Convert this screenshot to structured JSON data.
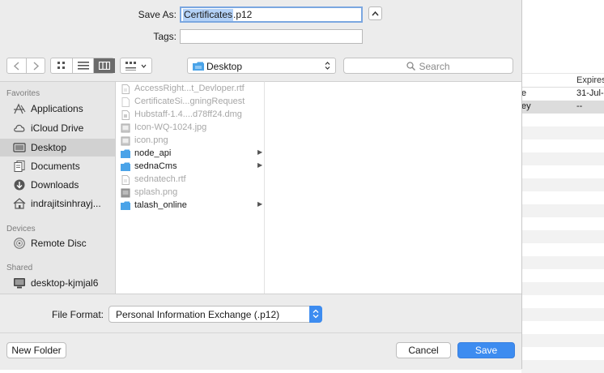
{
  "dialog": {
    "save_as_label": "Save As:",
    "filename_selected": "Certificates",
    "filename_ext": ".p12",
    "tags_label": "Tags:",
    "tags_value": ""
  },
  "toolbar": {
    "location": "Desktop",
    "search_placeholder": "Search"
  },
  "sidebar": {
    "favorites_header": "Favorites",
    "favorites": [
      {
        "label": "Applications",
        "icon": "applications-icon"
      },
      {
        "label": "iCloud Drive",
        "icon": "cloud-icon"
      },
      {
        "label": "Desktop",
        "icon": "desktop-icon",
        "active": true
      },
      {
        "label": "Documents",
        "icon": "documents-icon"
      },
      {
        "label": "Downloads",
        "icon": "downloads-icon"
      },
      {
        "label": "indrajitsinhrayj...",
        "icon": "home-icon"
      }
    ],
    "devices_header": "Devices",
    "devices": [
      {
        "label": "Remote Disc",
        "icon": "disc-icon"
      }
    ],
    "shared_header": "Shared",
    "shared": [
      {
        "label": "desktop-kjmjal6",
        "icon": "computer-icon"
      }
    ]
  },
  "files": [
    {
      "name": "AccessRight...t_Devloper.rtf",
      "kind": "doc",
      "dim": true
    },
    {
      "name": "CertificateSi...gningRequest",
      "kind": "blank",
      "dim": true
    },
    {
      "name": "Hubstaff-1.4....d78ff24.dmg",
      "kind": "dmg",
      "dim": true
    },
    {
      "name": "Icon-WQ-1024.jpg",
      "kind": "image",
      "dim": true
    },
    {
      "name": "icon.png",
      "kind": "image",
      "dim": true
    },
    {
      "name": "node_api",
      "kind": "folder",
      "dim": false
    },
    {
      "name": "sednaCms",
      "kind": "folder",
      "dim": false
    },
    {
      "name": "sednatech.rtf",
      "kind": "doc",
      "dim": true
    },
    {
      "name": "splash.png",
      "kind": "image",
      "dim": true
    },
    {
      "name": "talash_online",
      "kind": "folder",
      "dim": false
    }
  ],
  "format": {
    "label": "File Format:",
    "value": "Personal Information Exchange (.p12)"
  },
  "buttons": {
    "new_folder": "New Folder",
    "cancel": "Cancel",
    "save": "Save"
  },
  "background": {
    "header_expires": "Expires",
    "rows": [
      {
        "a": "e",
        "b": "31-Jul-"
      },
      {
        "a": "ey",
        "b": "--"
      }
    ]
  },
  "colors": {
    "accent": "#3d8cf0",
    "folder": "#4aa3e8"
  }
}
